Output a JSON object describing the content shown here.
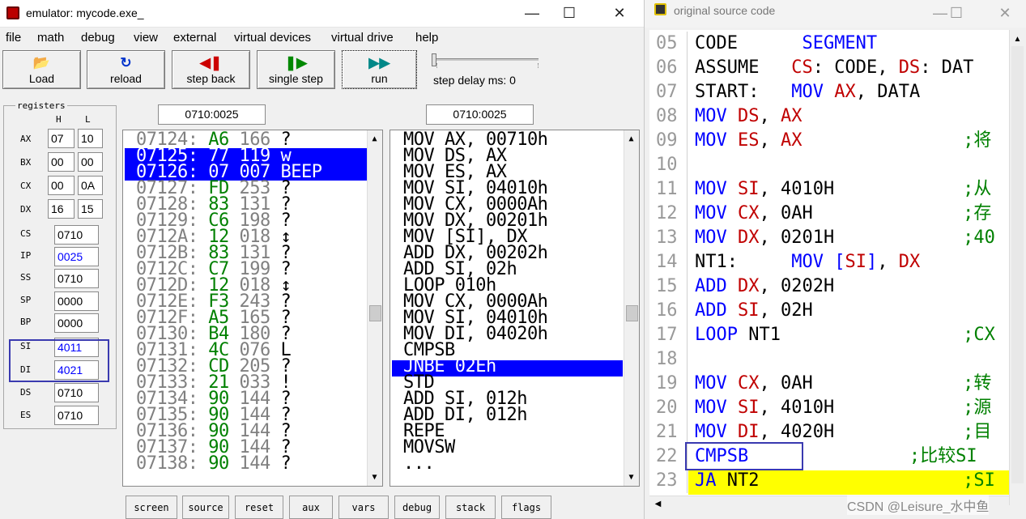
{
  "emulator": {
    "title": "emulator: mycode.exe_",
    "menu": [
      "file",
      "math",
      "debug",
      "view",
      "external",
      "virtual devices",
      "virtual drive",
      "help"
    ],
    "toolbar": {
      "load": "Load",
      "reload": "reload",
      "step_back": "step back",
      "single_step": "single step",
      "run": "run",
      "step_delay": "step delay ms: 0"
    },
    "registers": {
      "label": "registers",
      "h": "H",
      "l": "L",
      "ax": {
        "name": "AX",
        "h": "07",
        "l": "10"
      },
      "bx": {
        "name": "BX",
        "h": "00",
        "l": "00"
      },
      "cx": {
        "name": "CX",
        "h": "00",
        "l": "0A"
      },
      "dx": {
        "name": "DX",
        "h": "16",
        "l": "15"
      },
      "cs": {
        "name": "CS",
        "v": "0710"
      },
      "ip": {
        "name": "IP",
        "v": "0025"
      },
      "ss": {
        "name": "SS",
        "v": "0710"
      },
      "sp": {
        "name": "SP",
        "v": "0000"
      },
      "bp": {
        "name": "BP",
        "v": "0000"
      },
      "si": {
        "name": "SI",
        "v": "4011"
      },
      "di": {
        "name": "DI",
        "v": "4021"
      },
      "ds": {
        "name": "DS",
        "v": "0710"
      },
      "es": {
        "name": "ES",
        "v": "0710"
      }
    },
    "mem_address": "0710:0025",
    "dis_address": "0710:0025",
    "memory": [
      {
        "addr": "07124:",
        "hex": "A6",
        "dec": "166",
        "ch": "?"
      },
      {
        "addr": "07125:",
        "hex": "77",
        "dec": "119",
        "ch": "w"
      },
      {
        "addr": "07126:",
        "hex": "07",
        "dec": "007",
        "ch": "BEEP"
      },
      {
        "addr": "07127:",
        "hex": "FD",
        "dec": "253",
        "ch": "?"
      },
      {
        "addr": "07128:",
        "hex": "83",
        "dec": "131",
        "ch": "?"
      },
      {
        "addr": "07129:",
        "hex": "C6",
        "dec": "198",
        "ch": "?"
      },
      {
        "addr": "0712A:",
        "hex": "12",
        "dec": "018",
        "ch": "↕"
      },
      {
        "addr": "0712B:",
        "hex": "83",
        "dec": "131",
        "ch": "?"
      },
      {
        "addr": "0712C:",
        "hex": "C7",
        "dec": "199",
        "ch": "?"
      },
      {
        "addr": "0712D:",
        "hex": "12",
        "dec": "018",
        "ch": "↕"
      },
      {
        "addr": "0712E:",
        "hex": "F3",
        "dec": "243",
        "ch": "?"
      },
      {
        "addr": "0712F:",
        "hex": "A5",
        "dec": "165",
        "ch": "?"
      },
      {
        "addr": "07130:",
        "hex": "B4",
        "dec": "180",
        "ch": "?"
      },
      {
        "addr": "07131:",
        "hex": "4C",
        "dec": "076",
        "ch": "L"
      },
      {
        "addr": "07132:",
        "hex": "CD",
        "dec": "205",
        "ch": "?"
      },
      {
        "addr": "07133:",
        "hex": "21",
        "dec": "033",
        "ch": "!"
      },
      {
        "addr": "07134:",
        "hex": "90",
        "dec": "144",
        "ch": "?"
      },
      {
        "addr": "07135:",
        "hex": "90",
        "dec": "144",
        "ch": "?"
      },
      {
        "addr": "07136:",
        "hex": "90",
        "dec": "144",
        "ch": "?"
      },
      {
        "addr": "07137:",
        "hex": "90",
        "dec": "144",
        "ch": "?"
      },
      {
        "addr": "07138:",
        "hex": "90",
        "dec": "144",
        "ch": "?"
      }
    ],
    "disassembly": [
      "MOV AX, 00710h",
      "MOV DS, AX",
      "MOV ES, AX",
      "MOV SI, 04010h",
      "MOV CX, 0000Ah",
      "MOV DX, 00201h",
      "MOV [SI], DX",
      "ADD DX, 00202h",
      "ADD SI, 02h",
      "LOOP 010h",
      "MOV CX, 0000Ah",
      "MOV SI, 04010h",
      "MOV DI, 04020h",
      "CMPSB",
      "JNBE 02Eh",
      "STD",
      "ADD SI, 012h",
      "ADD DI, 012h",
      "REPE",
      "MOVSW",
      "..."
    ],
    "bottom_tabs": [
      "screen",
      "source",
      "reset",
      "aux",
      "vars",
      "debug",
      "stack",
      "flags"
    ]
  },
  "source": {
    "title": "original source code",
    "lines": [
      {
        "n": "05",
        "c": "CODE      SEGMENT"
      },
      {
        "n": "06",
        "c": "ASSUME   CS: CODE, DS: DAT"
      },
      {
        "n": "07",
        "c": "START:   MOV AX, DATA"
      },
      {
        "n": "08",
        "c": "MOV DS, AX"
      },
      {
        "n": "09",
        "c": "MOV ES, AX               ;将"
      },
      {
        "n": "10",
        "c": ""
      },
      {
        "n": "11",
        "c": "MOV SI, 4010H            ;从"
      },
      {
        "n": "12",
        "c": "MOV CX, 0AH              ;存"
      },
      {
        "n": "13",
        "c": "MOV DX, 0201H            ;40"
      },
      {
        "n": "14",
        "c": "NT1:     MOV [SI], DX"
      },
      {
        "n": "15",
        "c": "ADD DX, 0202H"
      },
      {
        "n": "16",
        "c": "ADD SI, 02H"
      },
      {
        "n": "17",
        "c": "LOOP NT1                 ;CX"
      },
      {
        "n": "18",
        "c": ""
      },
      {
        "n": "19",
        "c": "MOV CX, 0AH              ;转"
      },
      {
        "n": "20",
        "c": "MOV SI, 4010H            ;源"
      },
      {
        "n": "21",
        "c": "MOV DI, 4020H            ;目"
      },
      {
        "n": "22",
        "c": "CMPSB               ;比较SI"
      },
      {
        "n": "23",
        "c": "JA NT2                   ;SI"
      }
    ],
    "watermark": "CSDN @Leisure_水中鱼"
  },
  "colors": {
    "selection": "#0000ff",
    "highlight_line": "#ffff00",
    "annotation_box": "#3a3ab0",
    "hex_green": "#008000"
  }
}
